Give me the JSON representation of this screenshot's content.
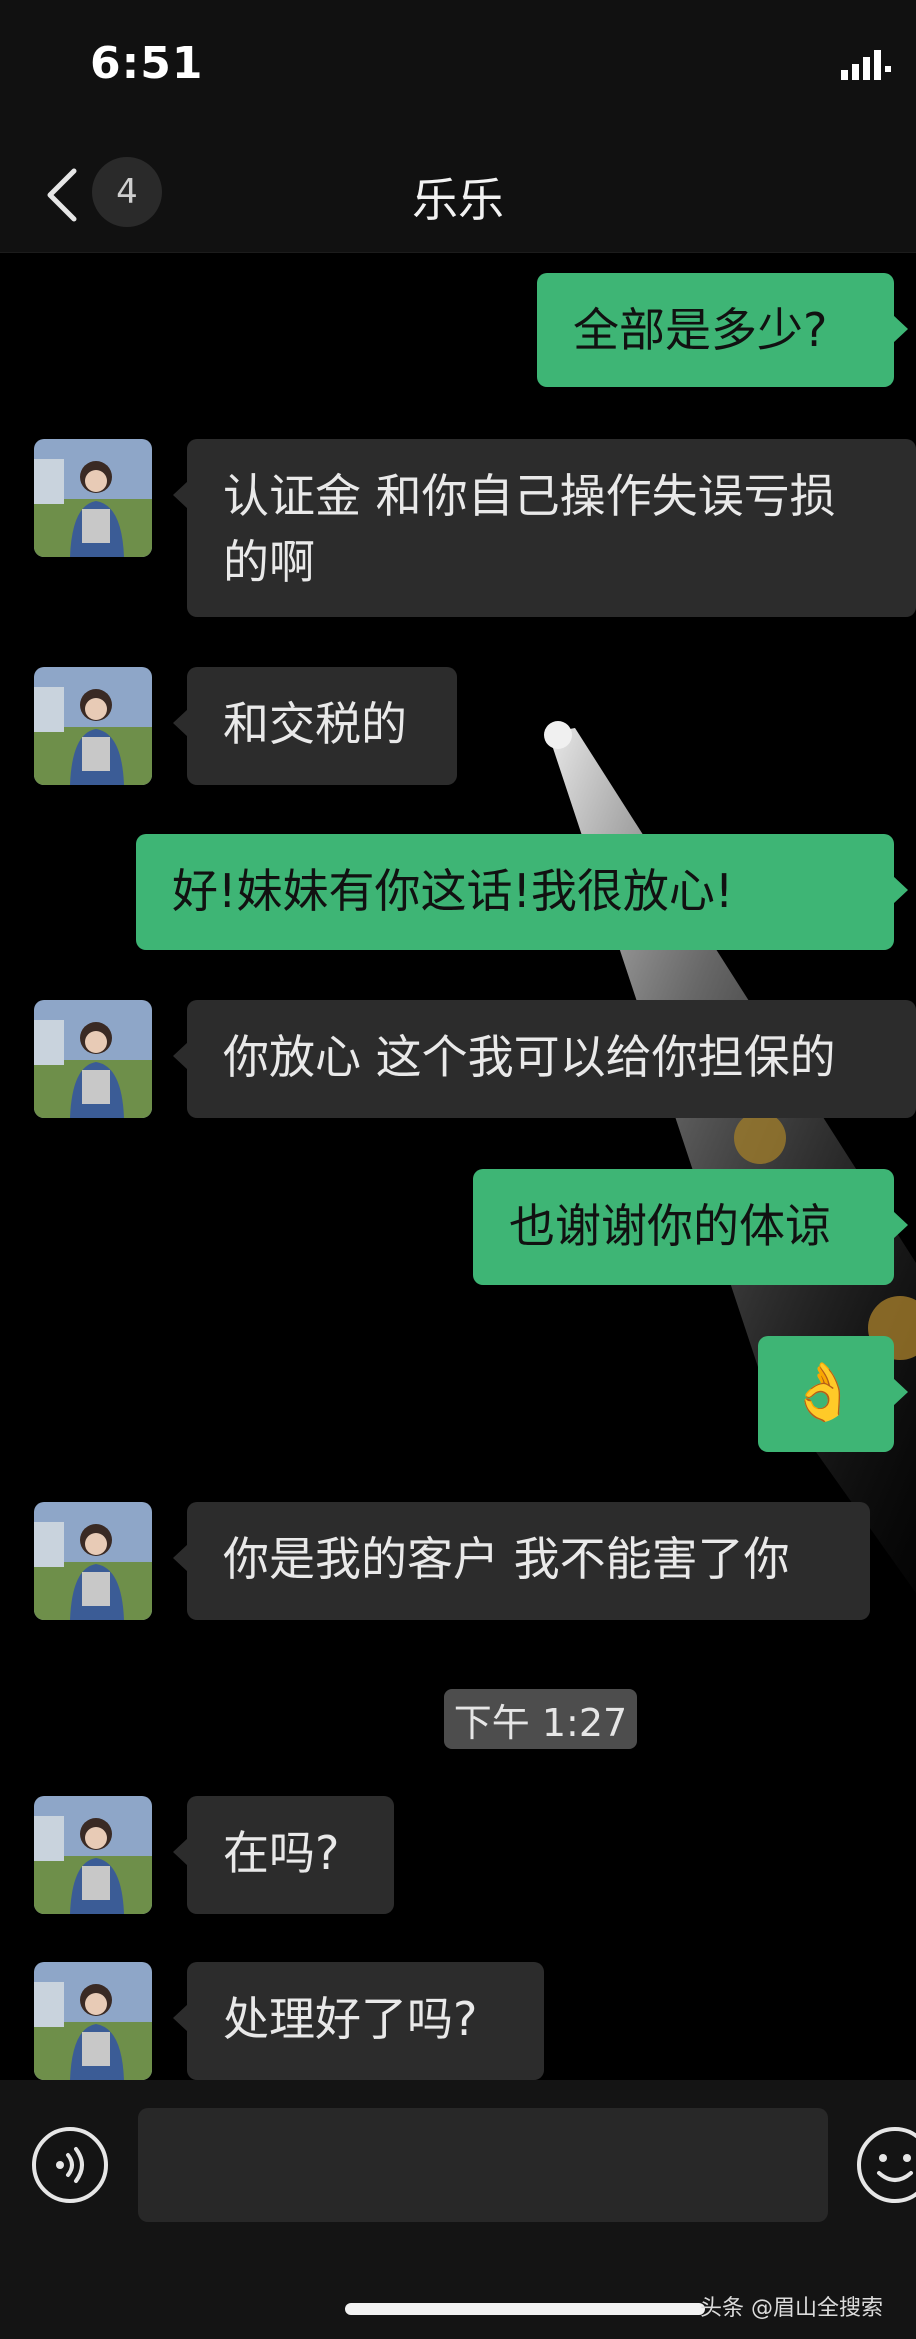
{
  "status_bar": {
    "time": "6:51"
  },
  "nav": {
    "unread_count": "4",
    "title": "乐乐"
  },
  "messages": [
    {
      "side": "right",
      "text": "全部是多少?"
    },
    {
      "side": "left",
      "text": "认证金 和你自己操作失误亏损的啊"
    },
    {
      "side": "left",
      "text": "和交税的"
    },
    {
      "side": "right",
      "text": "好!妹妹有你这话!我很放心!"
    },
    {
      "side": "left",
      "text": "你放心 这个我可以给你担保的"
    },
    {
      "side": "right",
      "text": "也谢谢你的体谅"
    },
    {
      "side": "right",
      "text": "👌"
    },
    {
      "side": "left",
      "text": "你是我的客户 我不能害了你"
    },
    {
      "side": "left",
      "text": "在吗?"
    },
    {
      "side": "left",
      "text": "处理好了吗?"
    }
  ],
  "timestamp": "下午 1:27",
  "input": {
    "value": ""
  },
  "watermark": "头条 @眉山全搜索",
  "colors": {
    "sent_bubble": "#3eb575",
    "received_bubble": "#2c2c2c",
    "background": "#000000"
  },
  "icons": [
    "back-icon",
    "signal-icon",
    "voice-icon",
    "emoji-icon"
  ]
}
